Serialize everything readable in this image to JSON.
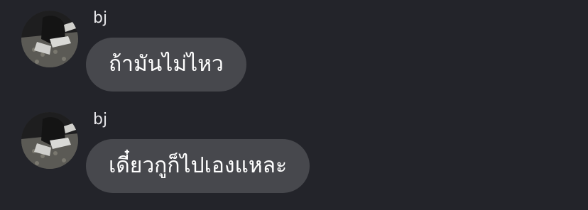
{
  "messages": [
    {
      "sender": "bj",
      "text": "ถ้ามันไม่ไหว"
    },
    {
      "sender": "bj",
      "text": "เดี๋ยวกูก็ไปเองแหละ"
    }
  ],
  "colors": {
    "background": "#23242a",
    "bubble": "#47484d",
    "text": "#ffffff"
  },
  "icons": {
    "avatar": "user-avatar-photo"
  }
}
